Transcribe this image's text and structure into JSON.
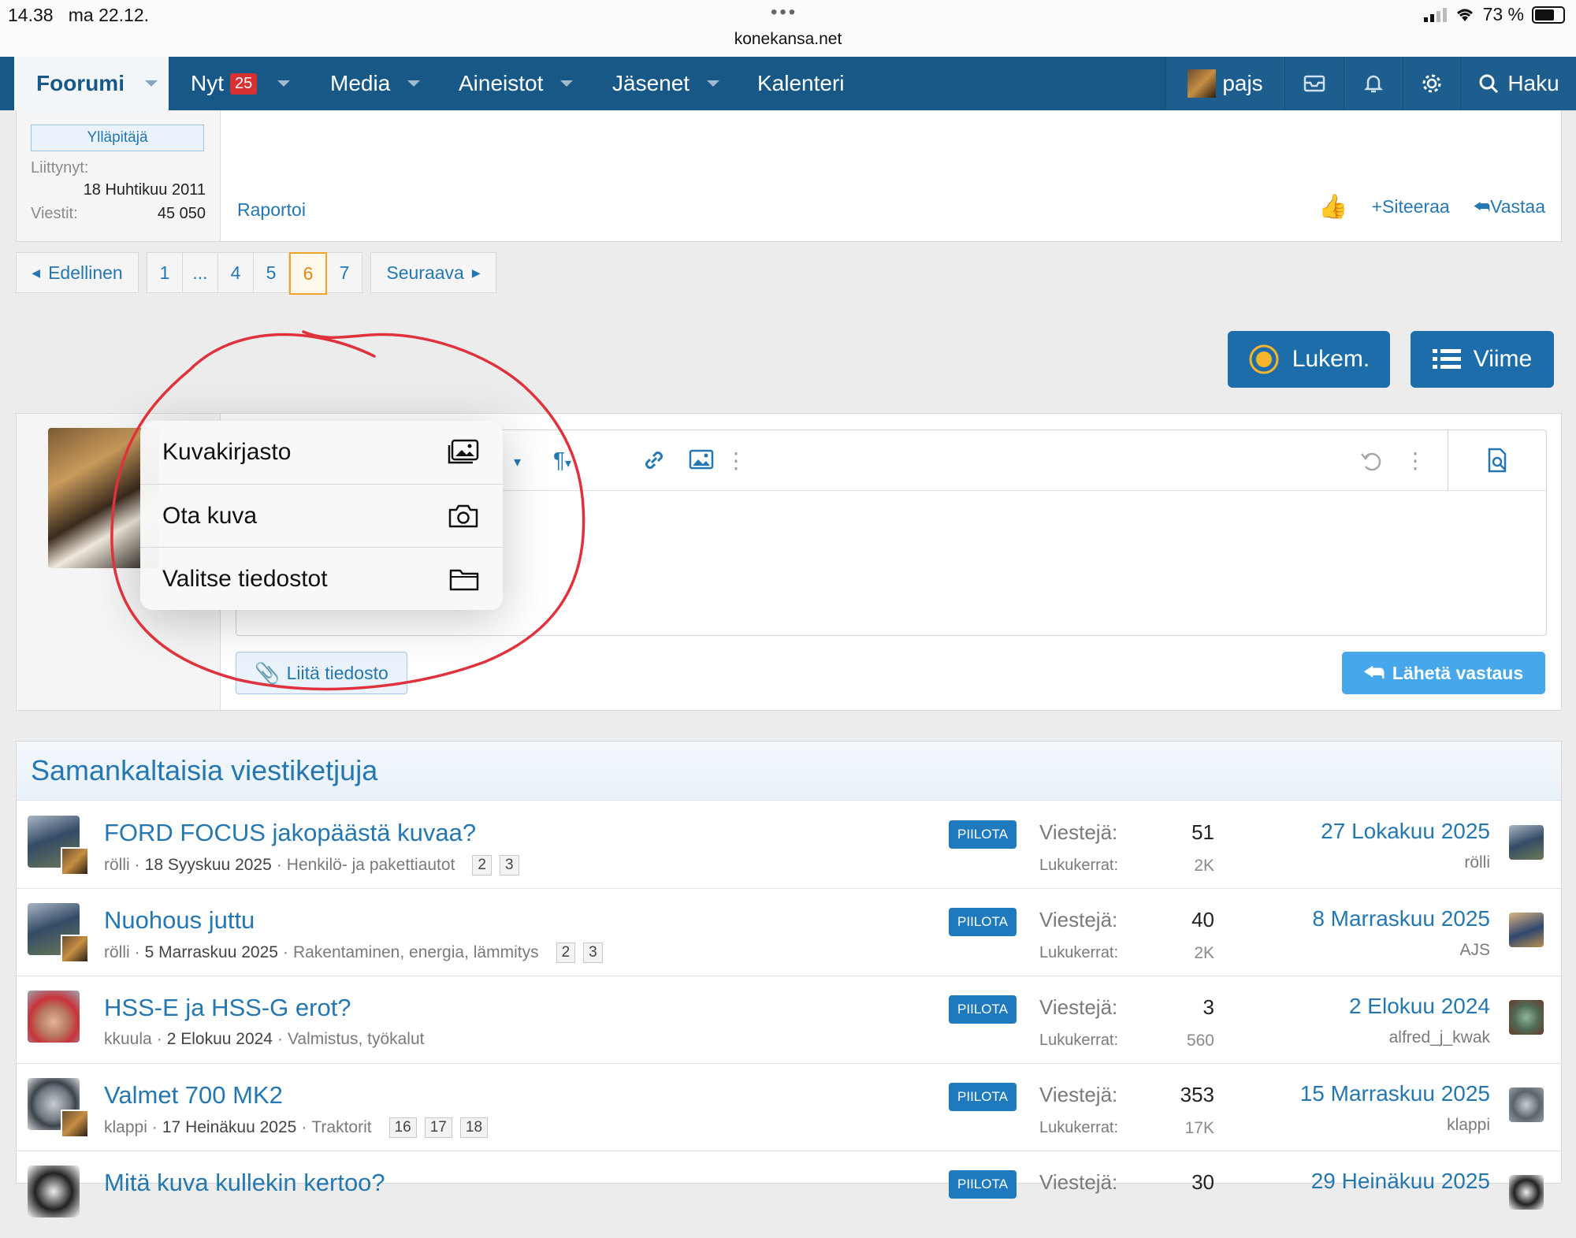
{
  "status": {
    "time": "14.38",
    "date": "ma 22.12.",
    "url": "konekansa.net",
    "battery": "73 %"
  },
  "nav": {
    "forum": "Foorumi",
    "now": "Nyt",
    "now_badge": "25",
    "media": "Media",
    "resources": "Aineistot",
    "members": "Jäsenet",
    "calendar": "Kalenteri",
    "user": "pajs",
    "search": "Haku"
  },
  "post_tail": {
    "role": "Ylläpitäjä",
    "joined_label": "Liittynyt:",
    "joined_value": "18 Huhtikuu 2011",
    "posts_label": "Viestit:",
    "posts_value": "45 050",
    "report": "Raportoi",
    "quote": "Siteeraa",
    "reply": "Vastaa"
  },
  "pagination": {
    "prev": "Edellinen",
    "pages": [
      "1",
      "...",
      "4",
      "5",
      "6",
      "7"
    ],
    "current": "6",
    "next": "Seuraava"
  },
  "buttons": {
    "unread": "Lukem.",
    "latest": "Viime"
  },
  "editor": {
    "attach": "Liitä tiedosto",
    "send": "Lähetä vastaus"
  },
  "popup": {
    "items": [
      {
        "label": "Kuvakirjasto",
        "icon": "photo-library-icon"
      },
      {
        "label": "Ota kuva",
        "icon": "camera-icon"
      },
      {
        "label": "Valitse tiedostot",
        "icon": "folder-icon"
      }
    ]
  },
  "similar": {
    "title": "Samankaltaisia viestiketjuja",
    "replies_label": "Viestejä:",
    "views_label": "Lukukerrat:",
    "tag": "PIILOTA",
    "threads": [
      {
        "title": "FORD FOCUS jakopäästä kuvaa?",
        "author": "rölli",
        "date": "18 Syyskuu 2025",
        "forum": "Henkilö- ja pakettiautot",
        "pages": [
          "2",
          "3"
        ],
        "replies": "51",
        "views": "2K",
        "last_date": "27 Lokakuu 2025",
        "last_user": "rölli"
      },
      {
        "title": "Nuohous juttu",
        "author": "rölli",
        "date": "5 Marraskuu 2025",
        "forum": "Rakentaminen, energia, lämmitys",
        "pages": [
          "2",
          "3"
        ],
        "replies": "40",
        "views": "2K",
        "last_date": "8 Marraskuu 2025",
        "last_user": "AJS"
      },
      {
        "title": "HSS-E ja HSS-G erot?",
        "author": "kkuula",
        "date": "2 Elokuu 2024",
        "forum": "Valmistus, työkalut",
        "pages": [],
        "replies": "3",
        "views": "560",
        "last_date": "2 Elokuu 2024",
        "last_user": "alfred_j_kwak"
      },
      {
        "title": "Valmet 700 MK2",
        "author": "klappi",
        "date": "17 Heinäkuu 2025",
        "forum": "Traktorit",
        "pages": [
          "16",
          "17",
          "18"
        ],
        "replies": "353",
        "views": "17K",
        "last_date": "15 Marraskuu 2025",
        "last_user": "klappi"
      },
      {
        "title": "Mitä kuva kullekin kertoo?",
        "author": "",
        "date": "",
        "forum": "",
        "pages": [],
        "replies": "30",
        "views": "",
        "last_date": "29 Heinäkuu 2025",
        "last_user": ""
      }
    ]
  },
  "colors": {
    "nav_bg": "#185886",
    "link": "#2577b1",
    "badge": "#d63133",
    "current_page": "#f2a427",
    "send": "#47a7eb",
    "annotation": "#e0323c"
  }
}
